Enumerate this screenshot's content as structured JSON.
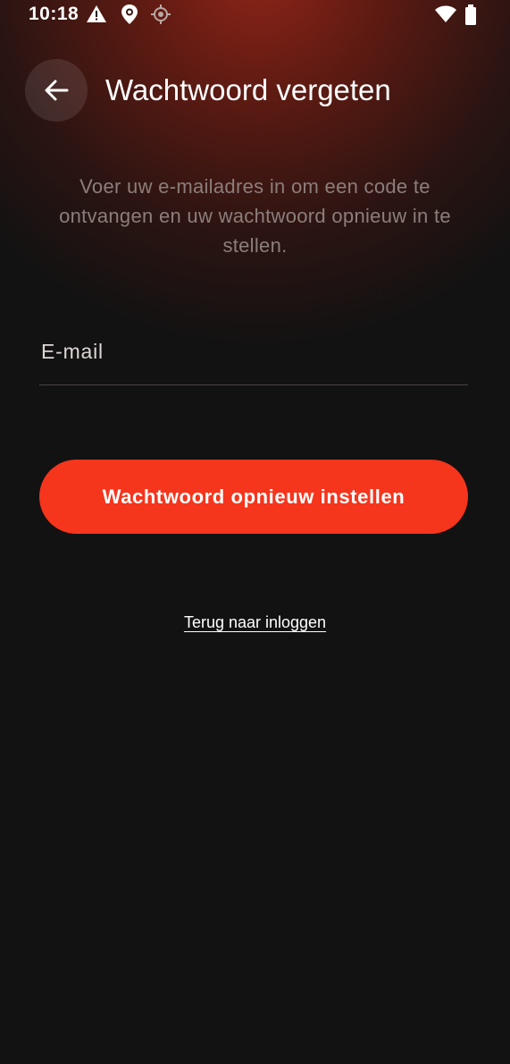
{
  "status_bar": {
    "time": "10:18",
    "left_icons": [
      "warning-icon",
      "location-pin-icon",
      "gps-target-icon"
    ],
    "right_icons": [
      "wifi-icon",
      "battery-icon"
    ]
  },
  "header": {
    "back_icon": "arrow-left-icon",
    "title": "Wachtwoord vergeten"
  },
  "description": "Voer uw e-mailadres in om een code te ontvangen en uw wachtwoord opnieuw in te stellen.",
  "form": {
    "email_placeholder": "E-mail",
    "email_value": ""
  },
  "actions": {
    "reset_button_label": "Wachtwoord opnieuw instellen",
    "back_to_login_label": "Terug naar inloggen"
  },
  "colors": {
    "background": "#121212",
    "accent": "#f5351c",
    "header_glow": "#8e2418",
    "muted_text": "#8c7e7b"
  }
}
